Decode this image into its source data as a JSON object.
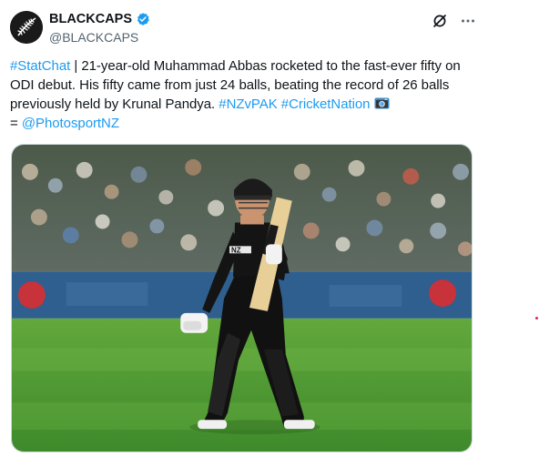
{
  "author": {
    "display_name": "BLACKCAPS",
    "handle": "@BLACKCAPS",
    "verified": true
  },
  "tweet": {
    "hashtag_statchat": "#StatChat",
    "body_1": " | 21-year-old Muhammad Abbas rocketed to the fast-ever fifty on ODI debut. His fifty came from just 24 balls, beating the record of 26 balls previously held by Krunal Pandya. ",
    "hashtag_nzvpak": "#NZvPAK",
    "hashtag_cricketnation": "#CricketNation",
    "camera_symbol": "camera-icon",
    "credit_prefix": " = ",
    "credit_mention": "@PhotosportNZ"
  },
  "media": {
    "shirt_text": "NZ"
  },
  "colors": {
    "link": "#1d9bf0",
    "text": "#0f1419",
    "secondary": "#536471",
    "verified": "#1d9bf0"
  },
  "icons": [
    "fern-logo-icon",
    "verified-badge-icon",
    "grok-icon",
    "more-icon",
    "camera-icon"
  ]
}
